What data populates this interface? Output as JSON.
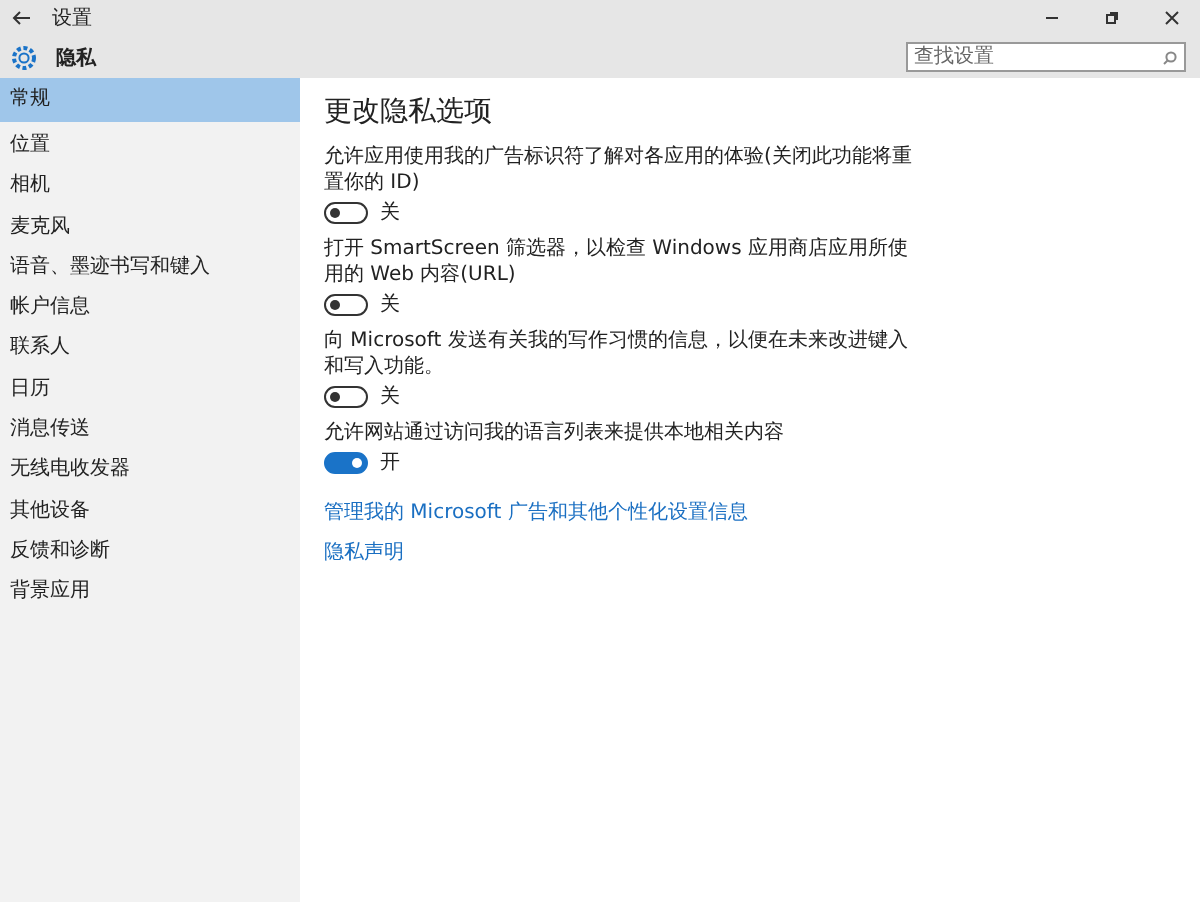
{
  "window": {
    "title": "设置"
  },
  "header": {
    "title": "隐私",
    "search": {
      "placeholder": "查找设置"
    }
  },
  "sidebar": {
    "items": [
      {
        "label": "常规",
        "selected": true
      },
      {
        "label": "位置",
        "selected": false
      },
      {
        "label": "相机",
        "selected": false
      },
      {
        "label": "麦克风",
        "selected": false
      },
      {
        "label": "语音、墨迹书写和键入",
        "selected": false
      },
      {
        "label": "帐户信息",
        "selected": false
      },
      {
        "label": "联系人",
        "selected": false
      },
      {
        "label": "日历",
        "selected": false
      },
      {
        "label": "消息传送",
        "selected": false
      },
      {
        "label": "无线电收发器",
        "selected": false
      },
      {
        "label": "其他设备",
        "selected": false
      },
      {
        "label": "反馈和诊断",
        "selected": false
      },
      {
        "label": "背景应用",
        "selected": false
      }
    ]
  },
  "content": {
    "title": "更改隐私选项",
    "settings": [
      {
        "description": "允许应用使用我的广告标识符了解对各应用的体验(关闭此功能将重置你的 ID)",
        "on": false,
        "state_label": "关"
      },
      {
        "description": "打开 SmartScreen 筛选器，以检查 Windows 应用商店应用所使用的 Web 内容(URL)",
        "on": false,
        "state_label": "关"
      },
      {
        "description": "向 Microsoft 发送有关我的写作习惯的信息，以便在未来改进键入和写入功能。",
        "on": false,
        "state_label": "关"
      },
      {
        "description": "允许网站通过访问我的语言列表来提供本地相关内容",
        "on": true,
        "state_label": "开"
      }
    ],
    "links": [
      "管理我的 Microsoft 广告和其他个性化设置信息",
      "隐私声明"
    ]
  }
}
